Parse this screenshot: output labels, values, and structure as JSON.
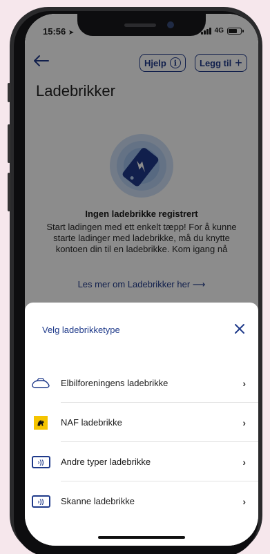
{
  "status_bar": {
    "time": "15:56",
    "network": "4G"
  },
  "header": {
    "help_label": "Hjelp",
    "add_label": "Legg til"
  },
  "page": {
    "title": "Ladebrikker",
    "empty_title": "Ingen ladebrikke registrert",
    "empty_desc": "Start ladingen med ett enkelt tæpp! For å kunne starte ladinger med ladebrikke, må du knytte kontoen din til en ladebrikke. Kom igang nå",
    "read_more": "Les mer om Ladebrikker her"
  },
  "sheet": {
    "title": "Velg ladebrikketype",
    "options": [
      {
        "label": "Elbilforeningens ladebrikke",
        "icon": "car-icon"
      },
      {
        "label": "NAF ladebrikke",
        "icon": "naf-logo-icon"
      },
      {
        "label": "Andre typer ladebrikke",
        "icon": "nfc-card-icon"
      },
      {
        "label": "Skanne ladebrikke",
        "icon": "nfc-card-icon"
      }
    ]
  },
  "colors": {
    "accent": "#1f3a8a",
    "naf_yellow": "#f5c400",
    "overlay": "rgba(0,0,0,0.45)"
  }
}
